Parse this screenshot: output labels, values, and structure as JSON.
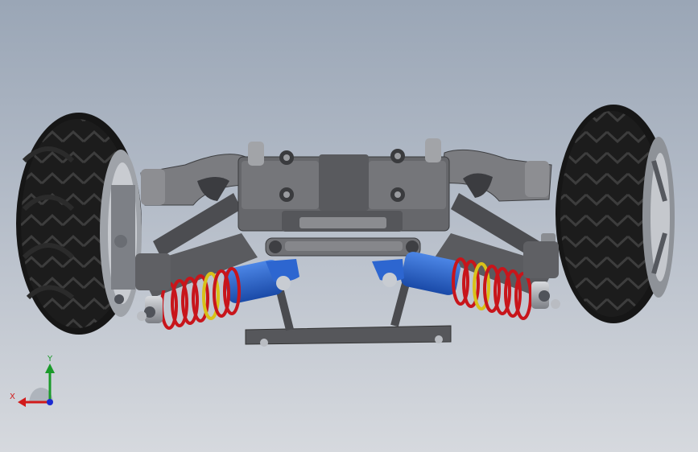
{
  "viewport": {
    "background_top": "#9aa6b6",
    "background_bottom": "#d6d9de"
  },
  "model": {
    "colors": {
      "tire": "#1c1c1c",
      "tread": "#3a3a3a",
      "chassis": "#5e5f63",
      "chassis_light": "#8a8b8f",
      "arm": "#6b6c70",
      "spring": "#c8151b",
      "shock_body": "#2a62c8",
      "shock_cap": "#1e4fb0",
      "metal": "#b9bcc2",
      "yellow": "#d8c21a"
    },
    "icons": {
      "tire": "tire-icon",
      "spring": "coil-spring-icon",
      "shock": "shock-absorber-icon"
    }
  },
  "triad": {
    "x_label": "X",
    "y_label": "Y",
    "x_color": "#d11b1b",
    "y_color": "#1a9a2a",
    "z_color": "#1b2ad1",
    "icons": {
      "triad": "coordinate-triad-icon"
    }
  }
}
